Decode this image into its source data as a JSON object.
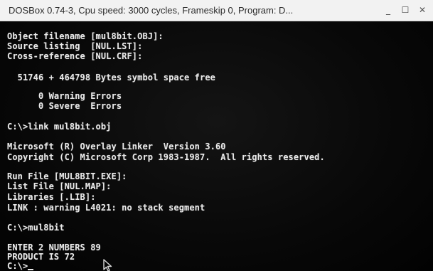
{
  "window": {
    "title": "DOSBox 0.74-3, Cpu speed:     3000 cycles, Frameskip  0, Program:   D...",
    "min_label": "_",
    "max_label": "☐",
    "close_label": "✕"
  },
  "terminal": {
    "lines": [
      "Object filename [mul8bit.OBJ]:",
      "Source listing  [NUL.LST]:",
      "Cross-reference [NUL.CRF]:",
      "",
      "  51746 + 464798 Bytes symbol space free",
      "",
      "      0 Warning Errors",
      "      0 Severe  Errors",
      "",
      "C:\\>link mul8bit.obj",
      "",
      "Microsoft (R) Overlay Linker  Version 3.60",
      "Copyright (C) Microsoft Corp 1983-1987.  All rights reserved.",
      "",
      "Run File [MUL8BIT.EXE]:",
      "List File [NUL.MAP]:",
      "Libraries [.LIB]:",
      "LINK : warning L4021: no stack segment",
      "",
      "C:\\>mul8bit",
      "",
      "ENTER 2 NUMBERS 89",
      "PRODUCT IS 72",
      "C:\\>"
    ]
  }
}
